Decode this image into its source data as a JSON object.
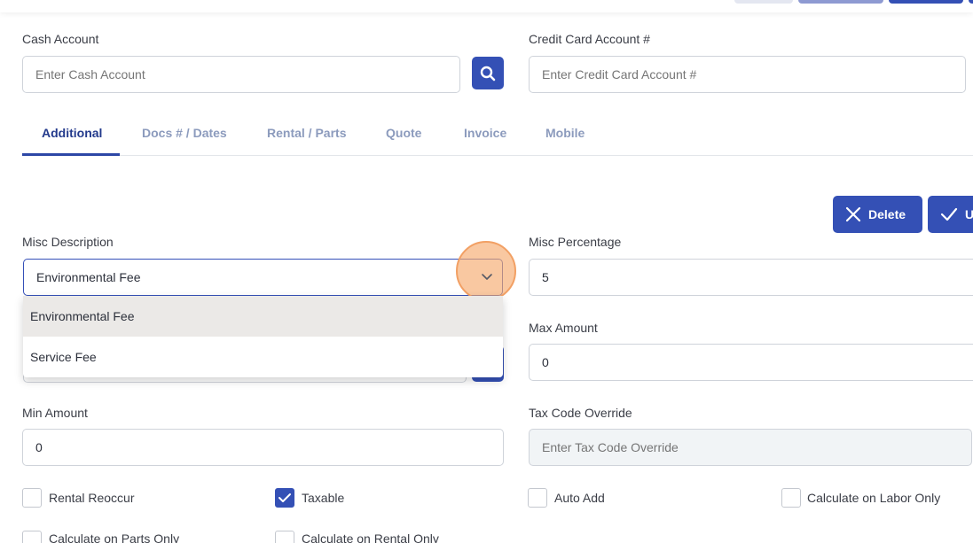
{
  "form": {
    "cash_account": {
      "label": "Cash Account",
      "placeholder": "Enter Cash Account"
    },
    "credit_card_account": {
      "label": "Credit Card Account #",
      "placeholder": "Enter Credit Card Account #"
    },
    "misc_description": {
      "label": "Misc Description",
      "value": "Environmental Fee"
    },
    "misc_percentage": {
      "label": "Misc Percentage",
      "value": "5"
    },
    "max_amount": {
      "label": "Max Amount",
      "value": "0"
    },
    "min_amount": {
      "label": "Min Amount",
      "value": "0"
    },
    "tax_code_override": {
      "label": "Tax Code Override",
      "placeholder": "Enter Tax Code Override"
    }
  },
  "tabs": [
    {
      "label": "Additional",
      "active": true
    },
    {
      "label": "Docs # / Dates"
    },
    {
      "label": "Rental / Parts"
    },
    {
      "label": "Quote"
    },
    {
      "label": "Invoice"
    },
    {
      "label": "Mobile"
    }
  ],
  "actions": {
    "delete_label": "Delete",
    "update_label": "U"
  },
  "dropdown": {
    "options": [
      "Environmental Fee",
      "Service Fee"
    ],
    "highlighted": "Environmental Fee"
  },
  "checkboxes": [
    {
      "label": "Rental Reoccur",
      "checked": false
    },
    {
      "label": "Taxable",
      "checked": true
    },
    {
      "label": "Auto Add",
      "checked": false
    },
    {
      "label": "Calculate on Labor Only",
      "checked": false
    },
    {
      "label": "Calculate on Parts Only",
      "checked": false
    },
    {
      "label": "Calculate on Rental Only",
      "checked": false
    }
  ],
  "colors": {
    "primary": "#3450b5",
    "tab_active": "#233a8c",
    "tab_inactive": "#8c9bbd",
    "highlight": "#f2a064"
  }
}
